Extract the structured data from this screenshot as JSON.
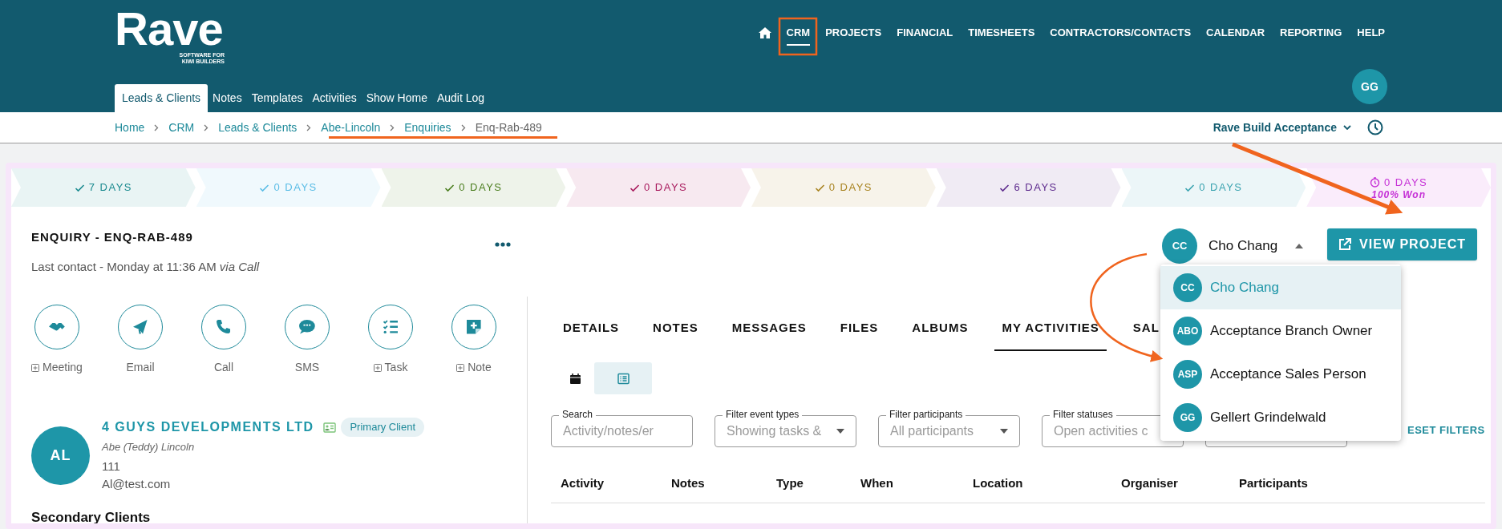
{
  "logo": {
    "wordmark": "Rave",
    "tagline_1": "SOFTWARE FOR",
    "tagline_2": "KIWI BUILDERS"
  },
  "top_nav": [
    {
      "label": "CRM",
      "selected": true
    },
    {
      "label": "PROJECTS",
      "selected": false
    },
    {
      "label": "FINANCIAL",
      "selected": false
    },
    {
      "label": "TIMESHEETS",
      "selected": false
    },
    {
      "label": "CONTRACTORS/CONTACTS",
      "selected": false
    },
    {
      "label": "CALENDAR",
      "selected": false
    },
    {
      "label": "REPORTING",
      "selected": false
    },
    {
      "label": "HELP",
      "selected": false
    }
  ],
  "sub_nav": [
    {
      "label": "Leads & Clients",
      "selected": true
    },
    {
      "label": "Notes",
      "selected": false
    },
    {
      "label": "Templates",
      "selected": false
    },
    {
      "label": "Activities",
      "selected": false
    },
    {
      "label": "Show Home",
      "selected": false
    },
    {
      "label": "Audit Log",
      "selected": false
    }
  ],
  "user_avatar": "GG",
  "breadcrumb": [
    "Home",
    "CRM",
    "Leads & Clients",
    "Abe-Lincoln",
    "Enquiries",
    "Enq-Rab-489"
  ],
  "company_selector": "Rave Build Acceptance",
  "stages": [
    {
      "kind": "done",
      "label": "7 DAYS",
      "color": "#1a8a8f"
    },
    {
      "kind": "done",
      "label": "0 DAYS",
      "color": "#5bbde6"
    },
    {
      "kind": "done",
      "label": "0 DAYS",
      "color": "#4a7d1e"
    },
    {
      "kind": "done",
      "label": "0 DAYS",
      "color": "#a8195c"
    },
    {
      "kind": "done",
      "label": "0 DAYS",
      "color": "#a88320"
    },
    {
      "kind": "done",
      "label": "6 DAYS",
      "color": "#5d2a8d"
    },
    {
      "kind": "done",
      "label": "0 DAYS",
      "color": "#3aa3b0"
    },
    {
      "kind": "current",
      "label": "0 DAYS",
      "subtitle": "100% Won",
      "color": "#c530d6"
    }
  ],
  "enquiry": {
    "title": "ENQUIRY - ENQ-RAB-489",
    "last_contact": "Last contact - Monday at 11:36 AM *via Call*"
  },
  "assignee": {
    "initials": "CC",
    "name": "Cho Chang",
    "expanded": true
  },
  "view_project_button": "VIEW PROJECT",
  "assignee_menu": [
    {
      "initials": "CC",
      "name": "Cho Chang",
      "selected": true
    },
    {
      "initials": "ABO",
      "name": "Acceptance Branch Owner",
      "selected": false
    },
    {
      "initials": "ASP",
      "name": "Acceptance Sales Person",
      "selected": false
    },
    {
      "initials": "GG",
      "name": "Gellert Grindelwald",
      "selected": false
    }
  ],
  "actions": [
    {
      "label": "Meeting",
      "add": true
    },
    {
      "label": "Email",
      "add": false
    },
    {
      "label": "Call",
      "add": false
    },
    {
      "label": "SMS",
      "add": false
    },
    {
      "label": "Task",
      "add": true
    },
    {
      "label": "Note",
      "add": true
    }
  ],
  "client": {
    "initials": "AL",
    "company": "4 GUYS DEVELOPMENTS LTD",
    "badge": "Primary Client",
    "contact": "Abe (Teddy) Lincoln",
    "phone": "111",
    "email": "Al@test.com"
  },
  "secondary_clients_heading": "Secondary Clients",
  "tabs": [
    {
      "label": "DETAILS",
      "selected": false
    },
    {
      "label": "NOTES",
      "selected": false
    },
    {
      "label": "MESSAGES",
      "selected": false
    },
    {
      "label": "FILES",
      "selected": false
    },
    {
      "label": "ALBUMS",
      "selected": false
    },
    {
      "label": "MY ACTIVITIES",
      "selected": true
    },
    {
      "label": "SAL",
      "selected": false
    }
  ],
  "view_toggle": [
    {
      "selected": false
    },
    {
      "selected": true
    }
  ],
  "filters": [
    {
      "label": "Search",
      "placeholder": "Activity/notes/er"
    },
    {
      "label": "Filter event types",
      "value": "Showing tasks &"
    },
    {
      "label": "Filter participants",
      "value": "All participants"
    },
    {
      "label": "Filter statuses",
      "value": "Open activities c"
    }
  ],
  "reset_filters": "ESET FILTERS",
  "table": {
    "columns": [
      "Activity",
      "Notes",
      "Type",
      "When",
      "Location",
      "Organiser",
      "Participants"
    ]
  }
}
